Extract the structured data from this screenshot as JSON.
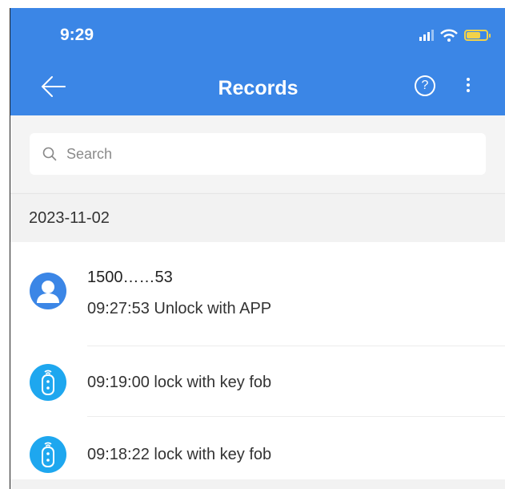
{
  "status_bar": {
    "time": "9:29",
    "icons": [
      "signal-icon",
      "wifi-icon",
      "battery-charging-icon"
    ]
  },
  "nav": {
    "title": "Records",
    "back_icon": "arrow-left-icon",
    "help_icon": "help-circle-icon",
    "more_icon": "more-vertical-icon"
  },
  "search": {
    "placeholder": "Search",
    "value": ""
  },
  "groups": [
    {
      "date": "2023-11-02",
      "records": [
        {
          "icon": "user-avatar-icon",
          "user": "1500……53",
          "text": "09:27:53 Unlock with APP"
        },
        {
          "icon": "key-fob-icon",
          "text": "09:19:00 lock with key fob"
        },
        {
          "icon": "key-fob-icon",
          "text": "09:18:22 lock with key fob"
        }
      ]
    }
  ],
  "colors": {
    "header": "#3b86e6",
    "avatar": "#3b86e6",
    "fob": "#1ea7ef",
    "battery": "#f2d24a",
    "background": "#f2f2f2"
  }
}
